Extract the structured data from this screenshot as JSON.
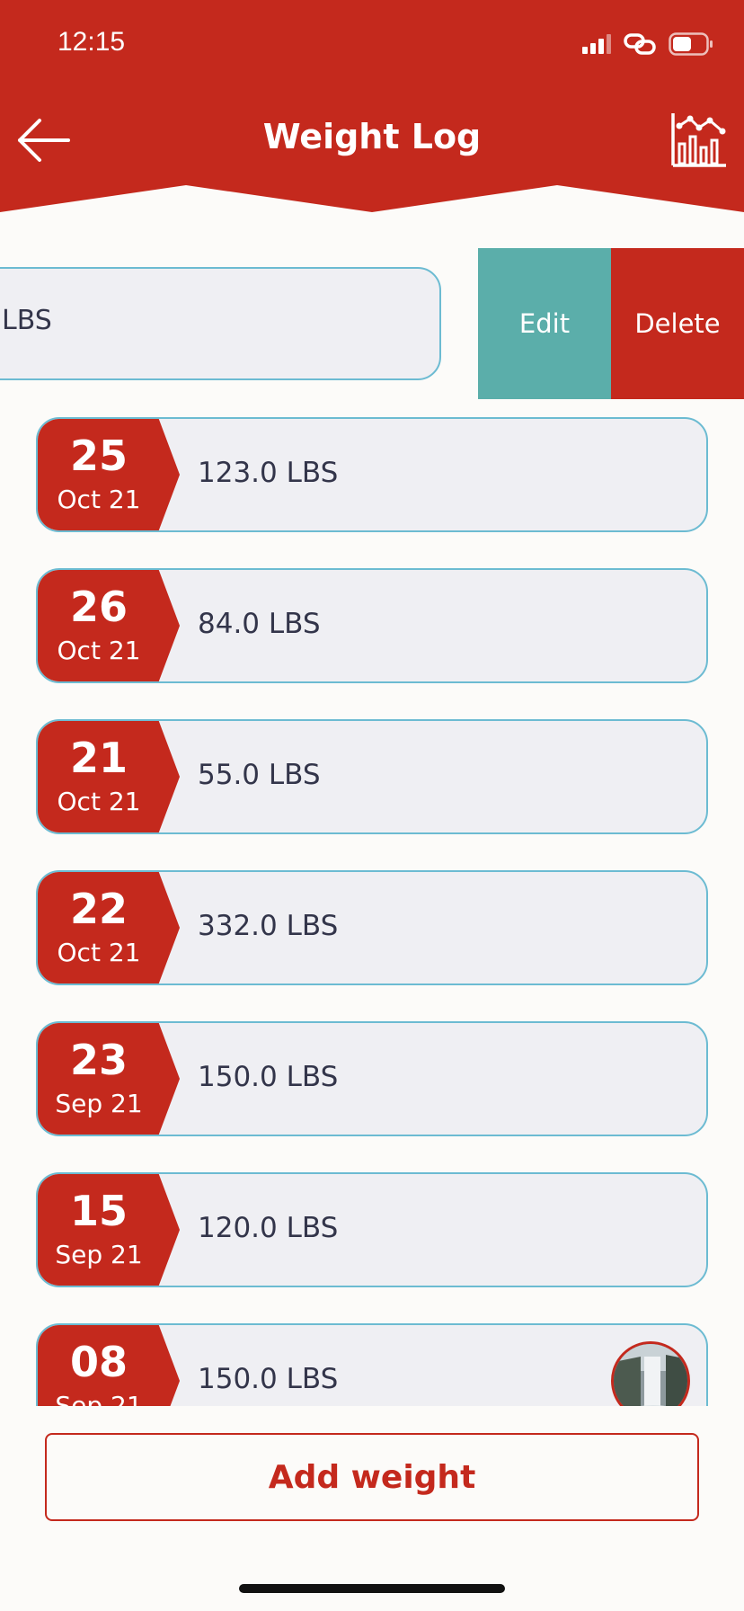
{
  "status_bar": {
    "time": "12:15"
  },
  "header": {
    "title": "Weight Log"
  },
  "swiped_entry": {
    "weight_partial": "LBS",
    "edit_label": "Edit",
    "delete_label": "Delete"
  },
  "entries": [
    {
      "day": "25",
      "month": "Oct 21",
      "weight": "123.0 LBS"
    },
    {
      "day": "26",
      "month": "Oct 21",
      "weight": "84.0 LBS"
    },
    {
      "day": "21",
      "month": "Oct 21",
      "weight": "55.0 LBS"
    },
    {
      "day": "22",
      "month": "Oct 21",
      "weight": "332.0 LBS"
    },
    {
      "day": "23",
      "month": "Sep 21",
      "weight": "150.0 LBS"
    },
    {
      "day": "15",
      "month": "Sep 21",
      "weight": "120.0 LBS"
    },
    {
      "day": "08",
      "month": "Sep 21",
      "weight": "150.0 LBS",
      "has_photo": true
    }
  ],
  "footer": {
    "add_label": "Add weight"
  },
  "colors": {
    "primary": "#c4291d",
    "accent_teal": "#5baeaa",
    "card_border": "#6cbbd2",
    "card_bg": "#efeff3",
    "background": "#fcfbf9"
  }
}
